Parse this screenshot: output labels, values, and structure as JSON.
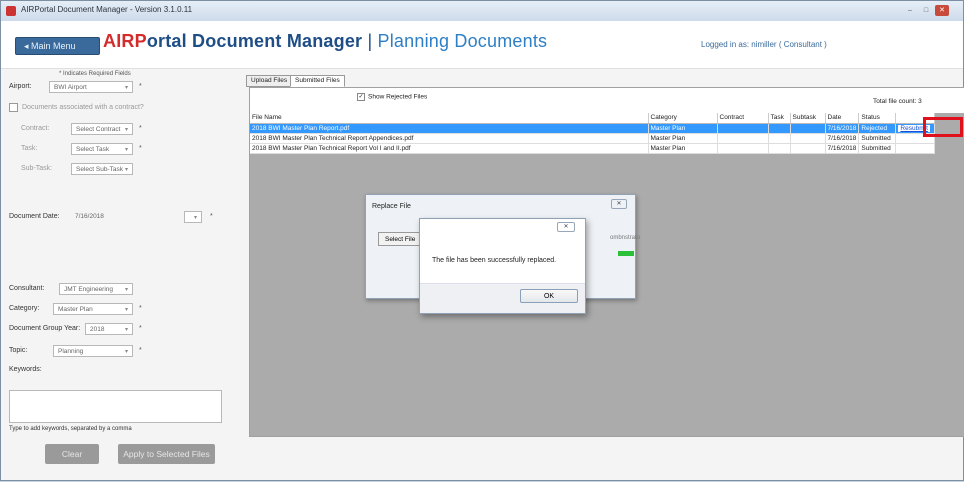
{
  "window": {
    "title": "AIRPortal Document Manager - Version 3.1.0.11",
    "min": "–",
    "max": "□",
    "close": "✕"
  },
  "header": {
    "main_menu": "Main Menu",
    "brand_air": "AIRP",
    "brand_rest": "ortal Document Manager",
    "brand_pipe": " | ",
    "brand_sub": "Planning Documents",
    "logged_in": "Logged in as: nimiller ( Consultant )"
  },
  "form": {
    "required_note": "* Indicates Required Fields",
    "airport_label": "Airport:",
    "airport_value": "BWI Airport",
    "contract_check_label": "Documents associated with a contract?",
    "contract_label": "Contract:",
    "contract_value": "Select Contract",
    "task_label": "Task:",
    "task_value": "Select Task",
    "subtask_label": "Sub-Task:",
    "subtask_value": "Select Sub-Task",
    "date_label": "Document Date:",
    "date_value": "7/16/2018",
    "consultant_label": "Consultant:",
    "consultant_value": "JMT Engineering",
    "category_label": "Category:",
    "category_value": "Master Plan",
    "year_label": "Document Group Year:",
    "year_value": "2018",
    "topic_label": "Topic:",
    "topic_value": "Planning",
    "keywords_label": "Keywords:",
    "keywords_hint": "Type to add keywords, separated by a comma",
    "star": "*",
    "clear_btn": "Clear",
    "apply_btn": "Apply to Selected Files"
  },
  "tabs": {
    "upload": "Upload Files",
    "submitted": "Submitted Files"
  },
  "files_panel": {
    "show_rejected": "Show Rejected Files",
    "show_rejected_checked": true,
    "total": "Total file count: 3",
    "columns": [
      "File Name",
      "Category",
      "Contract",
      "Task",
      "Subtask",
      "Date",
      "Status",
      ""
    ],
    "rows": [
      {
        "name": "2018 BWI Master Plan Report.pdf",
        "category": "Master Plan",
        "contract": "",
        "task": "",
        "subtask": "",
        "date": "7/16/2018",
        "status": "Rejected",
        "action": "Resubmit"
      },
      {
        "name": "2018 BWI Master Plan Technical Report Appendices.pdf",
        "category": "Master Plan",
        "contract": "",
        "task": "",
        "subtask": "",
        "date": "7/16/2018",
        "status": "Submitted",
        "action": ""
      },
      {
        "name": "2018 BWI Master Plan Technical Report Vol I and II.pdf",
        "category": "Master Plan",
        "contract": "",
        "task": "",
        "subtask": "",
        "date": "7/16/2018",
        "status": "Submitted",
        "action": ""
      }
    ]
  },
  "replace_dialog": {
    "title": "Replace File",
    "select_btn": "Select File",
    "ghost": "ombnstrato"
  },
  "message_box": {
    "text": "The file has been successfully replaced.",
    "ok": "OK"
  },
  "colors": {
    "highlight": "#e0101c",
    "selected_row": "#3399ff",
    "brand_red": "#d42b2b",
    "brand_blue": "#1f4e86"
  }
}
